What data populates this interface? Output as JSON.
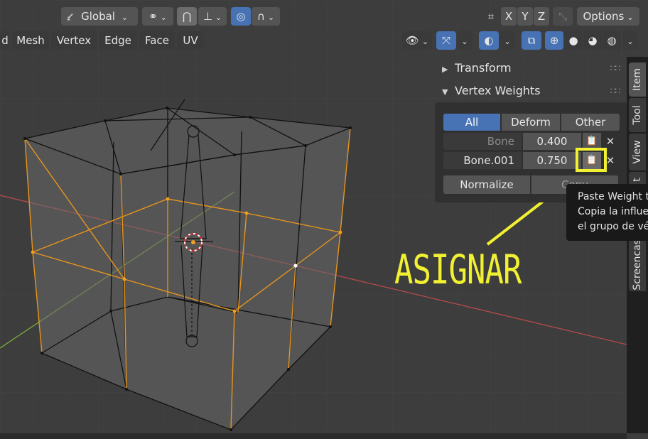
{
  "header": {
    "transform_orientation": "Global",
    "axes": [
      "X",
      "Y",
      "Z"
    ],
    "options_label": "Options"
  },
  "edit_menu": {
    "partial_left": "d",
    "items": [
      "Mesh",
      "Vertex",
      "Edge",
      "Face",
      "UV"
    ]
  },
  "panel": {
    "transform_title": "Transform",
    "vertex_weights_title": "Vertex Weights",
    "filter_tabs": [
      "All",
      "Deform",
      "Other"
    ],
    "active_filter": "All",
    "weights": [
      {
        "name": "Bone",
        "value": "0.400",
        "active": false
      },
      {
        "name": "Bone.001",
        "value": "0.750",
        "active": true
      }
    ],
    "normalize_label": "Normalize",
    "copy_label": "Copy"
  },
  "sidebar_tabs": [
    "Item",
    "Tool",
    "View",
    "t",
    "Screencast"
  ],
  "tooltip": {
    "line1": "Paste Weight t",
    "line2": "Copia la influe",
    "line3": "el grupo de vé"
  },
  "annotation": {
    "text": "ASIGNAR",
    "color": "#f1f132"
  },
  "colors": {
    "accent": "#4772b3",
    "selected_edge": "#e8951c",
    "x_axis": "#b34a4a",
    "y_axis": "#74a33a"
  }
}
